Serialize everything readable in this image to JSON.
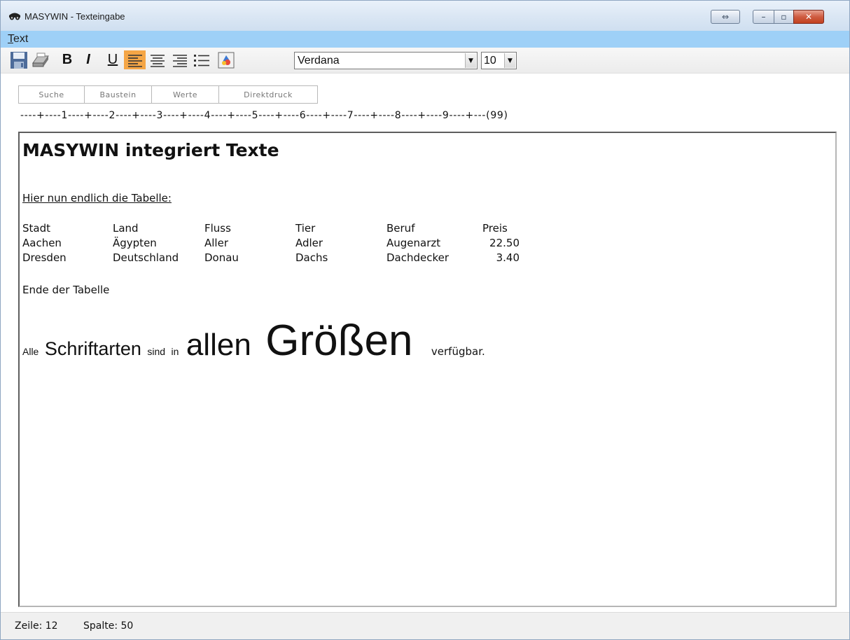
{
  "window": {
    "title": "MASYWIN - Texteingabe",
    "buttons": {
      "extra": "⇔",
      "minimize": "–",
      "maximize": "▫",
      "close": "✕"
    }
  },
  "menubar": {
    "text_accel": "T",
    "text_rest": "ext"
  },
  "toolbar": {
    "bold": "B",
    "italic": "I",
    "underline": "U",
    "font_name": "Verdana",
    "font_size": "10",
    "icons": [
      "save-icon",
      "print-icon",
      "align-left-icon",
      "align-center-icon",
      "align-right-icon",
      "bullet-list-icon",
      "color-icon"
    ]
  },
  "actions": {
    "search": "Suche",
    "block": "Baustein",
    "values": "Werte",
    "direct_print": "Direktdruck"
  },
  "ruler": "----+----1----+----2----+----3----+----4----+----5----+----6----+----7----+----8----+----9----+---(99)",
  "document": {
    "heading": "MASYWIN integriert Texte",
    "intro": "Hier nun endlich die Tabelle:",
    "table": {
      "headers": [
        "Stadt",
        "Land",
        "Fluss",
        "Tier",
        "Beruf",
        "Preis"
      ],
      "rows": [
        [
          "Aachen",
          "Ägypten",
          "Aller",
          "Adler",
          "Augenarzt",
          "22.50"
        ],
        [
          "Dresden",
          "Deutschland",
          "Donau",
          "Dachs",
          "Dachdecker",
          "3.40"
        ]
      ]
    },
    "table_end": "Ende der Tabelle",
    "sizes": [
      "Alle",
      "Schriftarten",
      "sind",
      "in",
      "allen",
      "Größen",
      "verfügbar."
    ]
  },
  "status": {
    "line": "Zeile: 12",
    "column": "Spalte: 50"
  },
  "colors": {
    "menubar": "#9ed0f7",
    "active_align": "#f5a646",
    "close_button": "#c2411f"
  }
}
